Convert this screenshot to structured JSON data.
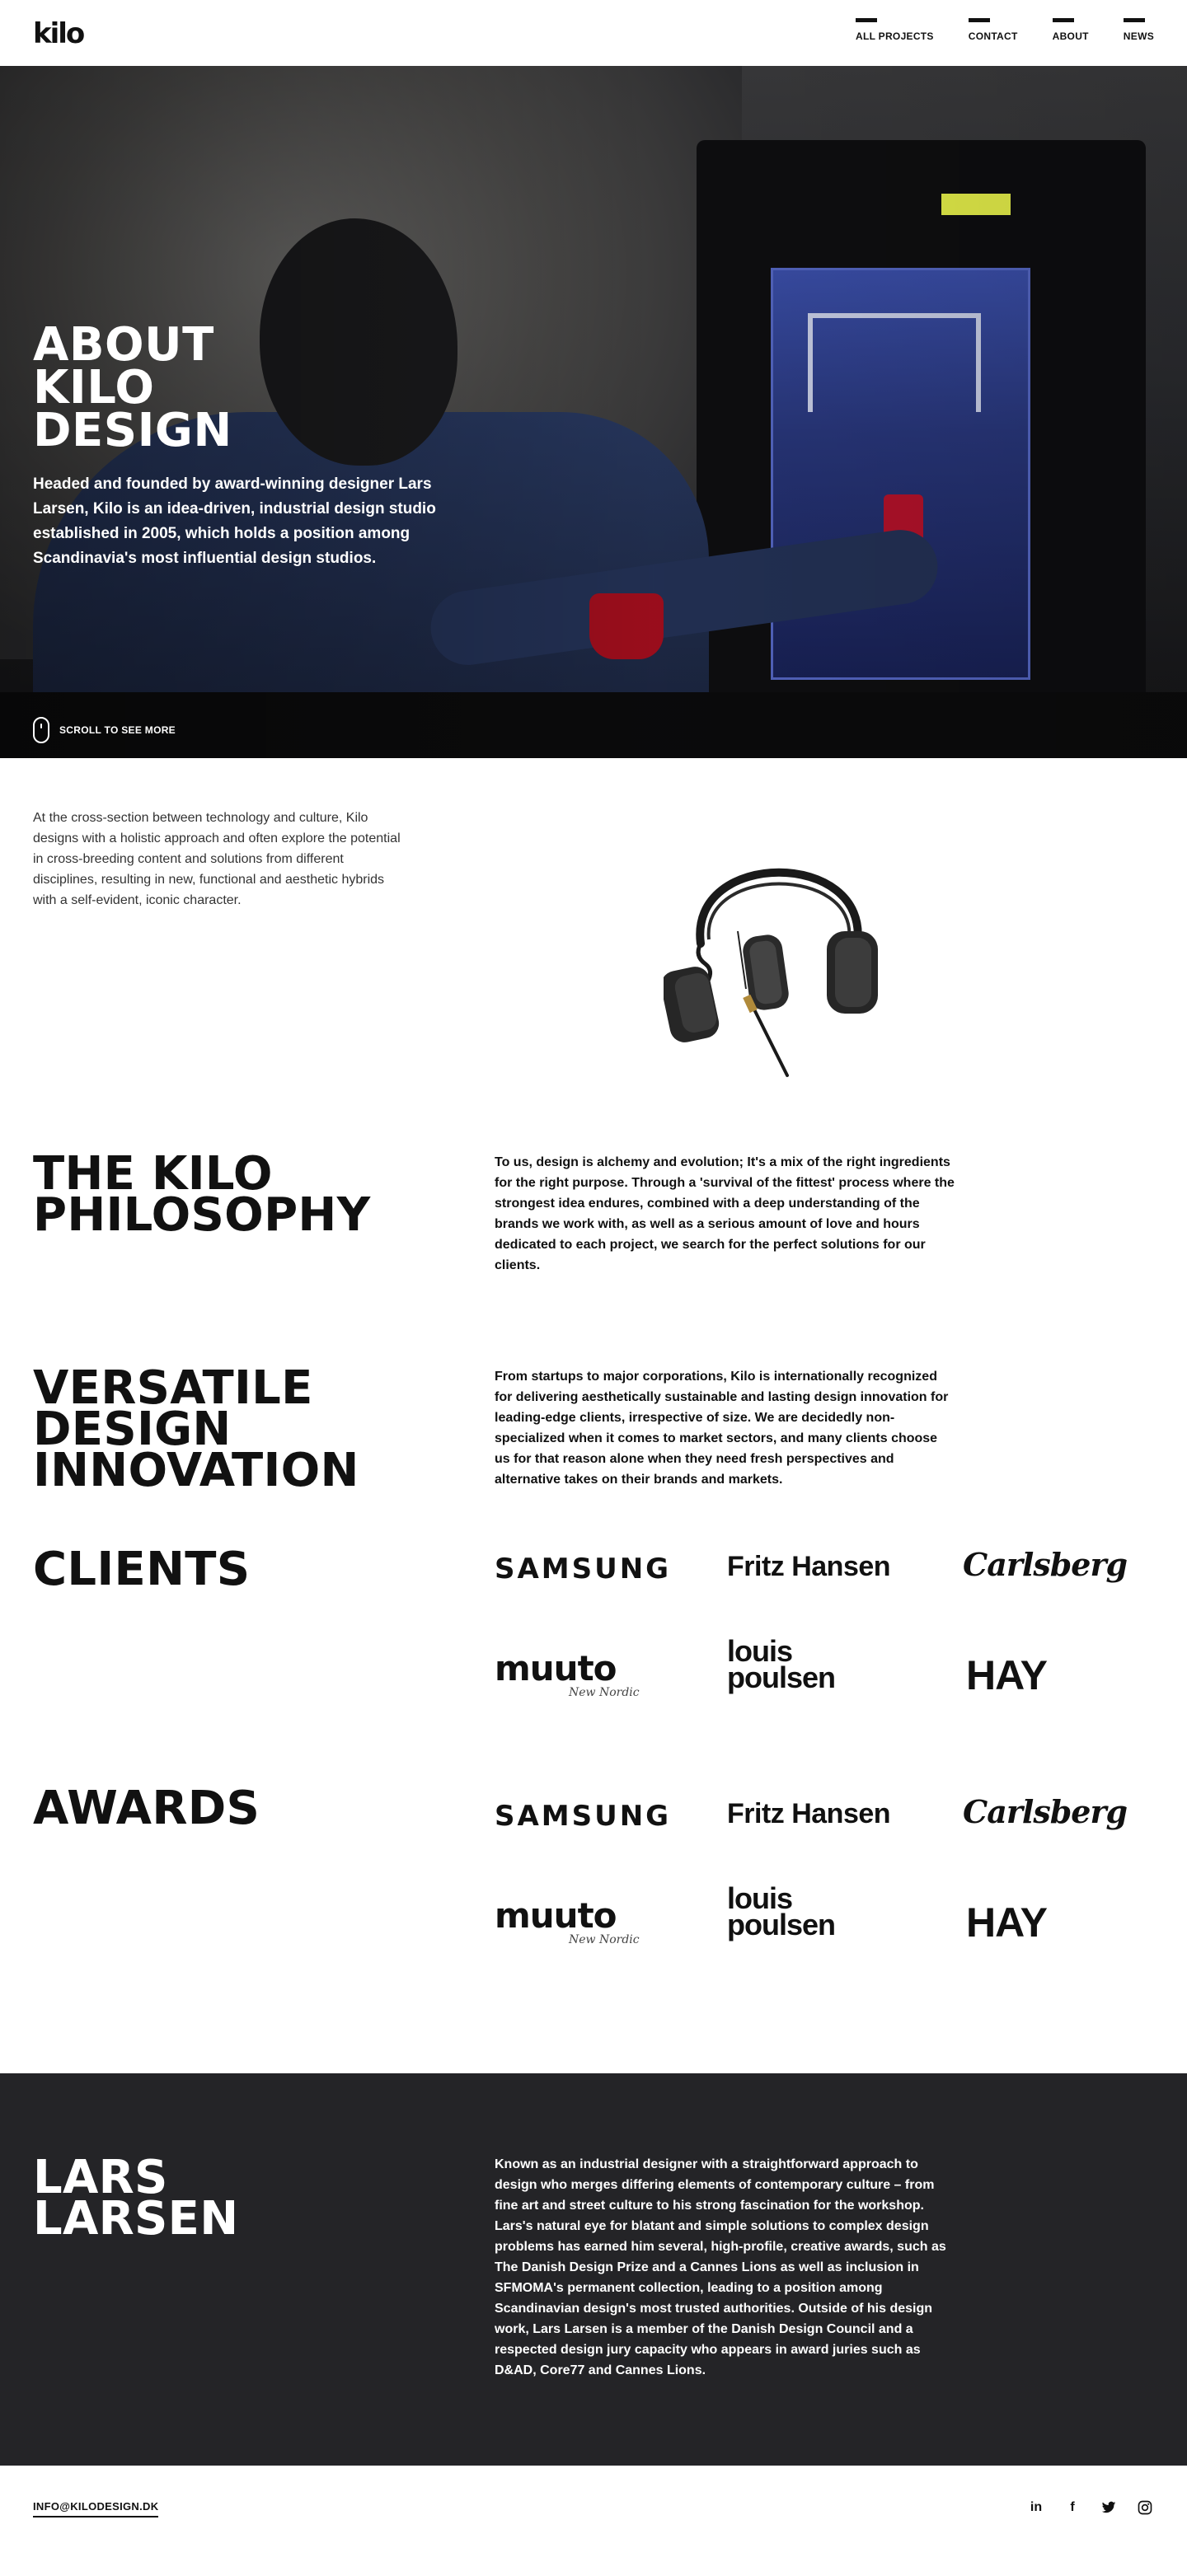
{
  "header": {
    "logo": "kilo",
    "nav": [
      {
        "label": "ALL PROJECTS"
      },
      {
        "label": "CONTACT"
      },
      {
        "label": "ABOUT"
      },
      {
        "label": "NEWS"
      }
    ]
  },
  "hero": {
    "title": "ABOUT\nKILO\nDESIGN",
    "intro": "Headed and founded by award-winning designer Lars Larsen, Kilo is an idea-driven, industrial design studio established in 2005, which holds a position among Scandinavia's most influential design studios.",
    "scroll_label": "SCROLL TO SEE MORE"
  },
  "intro": {
    "text": "At the cross-section between technology and culture, Kilo designs with a holistic approach and often explore the potential in cross-breeding content and solutions from different disciplines, resulting in new, functional and aesthetic hybrids with a self-evident, iconic character."
  },
  "philosophy": {
    "title": "THE KILO\nPHILOSOPHY",
    "body": "To us, design is alchemy and evolution; It's a mix of the right ingredients for the right purpose. Through a 'survival of the fittest' process where the strongest idea endures, combined with a deep understanding of the brands we work with, as well as a serious amount of love and hours dedicated to each project, we search for the perfect solutions for our clients."
  },
  "versatile": {
    "title": "VERSATILE\nDESIGN\nINNOVATION",
    "body": "From startups to major corporations, Kilo is internationally recognized for delivering aesthetically sustainable and lasting design innovation for leading-edge clients, irrespective of size. We are decidedly non-specialized when it comes to market sectors, and many clients choose us for that reason alone when they need fresh perspectives and alternative takes on their brands and markets."
  },
  "clients": {
    "title": "CLIENTS",
    "logos": {
      "samsung": "SAMSUNG",
      "fritz": "Fritz Hansen",
      "carlsberg": "Carlsberg",
      "muuto": "muuto",
      "muuto_sub": "New Nordic",
      "louis": "louis\npoulsen",
      "hay": "HAY"
    }
  },
  "awards": {
    "title": "AWARDS",
    "logos": {
      "samsung": "SAMSUNG",
      "fritz": "Fritz Hansen",
      "carlsberg": "Carlsberg",
      "muuto": "muuto",
      "muuto_sub": "New Nordic",
      "louis": "louis\npoulsen",
      "hay": "HAY"
    }
  },
  "founder": {
    "title": "LARS\nLARSEN",
    "body": "Known as an industrial designer with a straightforward approach to design who merges differing elements of contemporary culture – from fine art and street culture to his strong fascination for the workshop. Lars's natural eye for blatant and simple solutions to complex design problems has earned him several, high-profile, creative awards, such as The Danish Design Prize and a Cannes Lions as well as inclusion in SFMOMA's permanent collection, leading to a position among Scandinavian design's most trusted authorities. Outside of his design work, Lars Larsen is a member of the Danish Design Council and a respected design jury capacity who appears in award juries such as D&AD, Core77 and Cannes Lions."
  },
  "footer": {
    "email": "INFO@KILODESIGN.DK",
    "social": [
      {
        "icon": "linkedin-icon",
        "glyph": "in"
      },
      {
        "icon": "facebook-icon",
        "glyph": "f"
      },
      {
        "icon": "twitter-icon",
        "glyph": "t"
      },
      {
        "icon": "instagram-icon",
        "glyph": ""
      }
    ]
  },
  "colors": {
    "text": "#111111",
    "dark_section": "#242427",
    "background": "#ffffff"
  }
}
